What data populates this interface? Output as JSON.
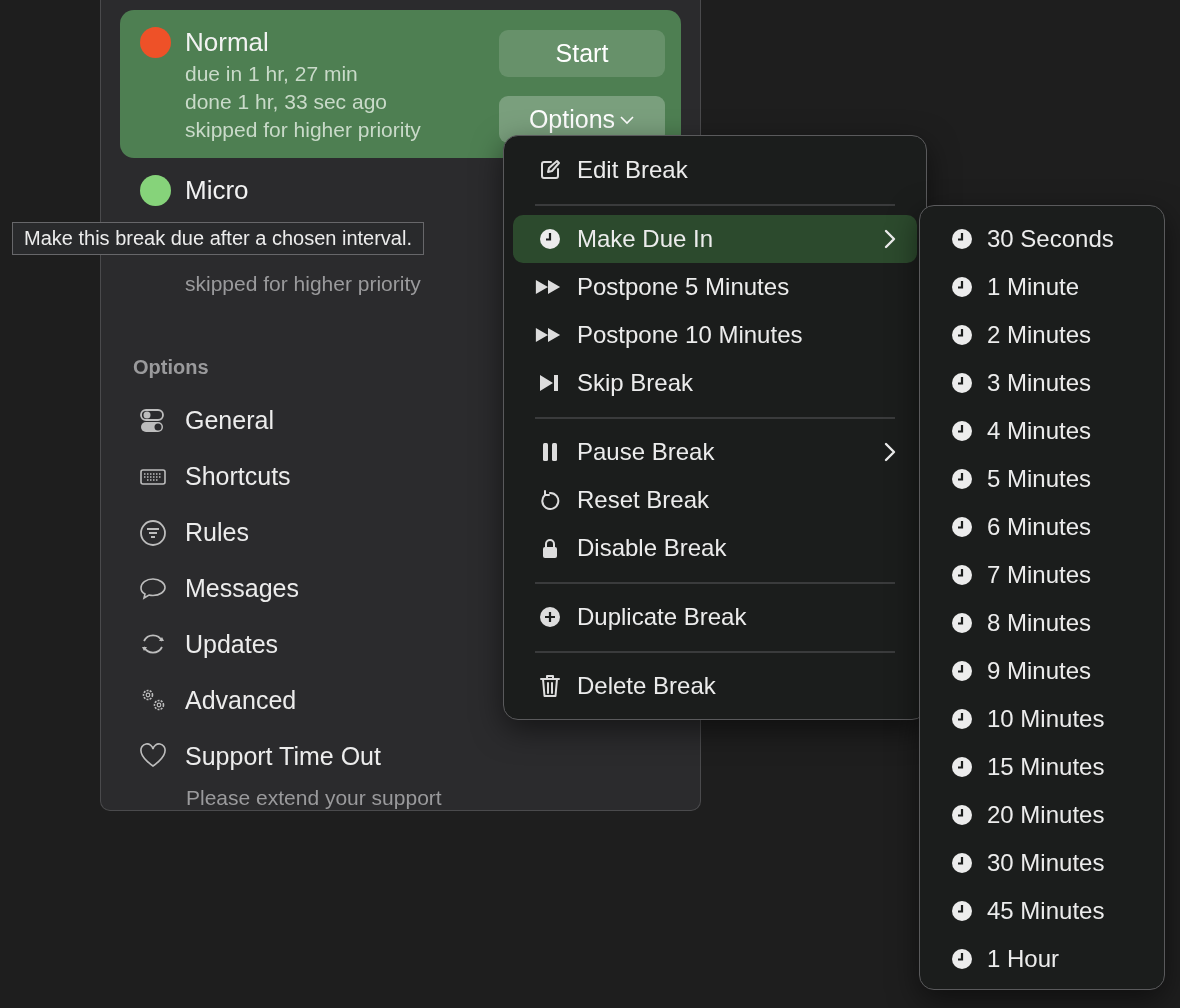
{
  "breaks": [
    {
      "name": "Normal",
      "color": "#ee5128",
      "selected": true,
      "lines": [
        "due in 1 hr, 27 min",
        "done 1 hr, 33 sec ago",
        "skipped for higher priority"
      ],
      "buttons": [
        {
          "label": "Start",
          "caret": false
        },
        {
          "label": "Options",
          "caret": true
        }
      ]
    },
    {
      "name": "Micro",
      "color": "#86d37a",
      "selected": false,
      "lines": [
        "skipped for higher priority"
      ]
    }
  ],
  "options": {
    "heading": "Options",
    "items": [
      "General",
      "Shortcuts",
      "Rules",
      "Messages",
      "Updates",
      "Advanced",
      "Support Time Out"
    ],
    "footer": "Please extend your support"
  },
  "tooltip": "Make this break due after a chosen interval.",
  "menu": {
    "groups": [
      [
        {
          "label": "Edit Break",
          "selected": false,
          "submenu": false
        }
      ],
      [
        {
          "label": "Make Due In",
          "selected": true,
          "submenu": true
        },
        {
          "label": "Postpone 5 Minutes",
          "selected": false,
          "submenu": false
        },
        {
          "label": "Postpone 10 Minutes",
          "selected": false,
          "submenu": false
        },
        {
          "label": "Skip Break",
          "selected": false,
          "submenu": false
        }
      ],
      [
        {
          "label": "Pause Break",
          "selected": false,
          "submenu": true
        },
        {
          "label": "Reset Break",
          "selected": false,
          "submenu": false
        },
        {
          "label": "Disable Break",
          "selected": false,
          "submenu": false
        }
      ],
      [
        {
          "label": "Duplicate Break",
          "selected": false,
          "submenu": false
        }
      ],
      [
        {
          "label": "Delete Break",
          "selected": false,
          "submenu": false
        }
      ]
    ]
  },
  "submenu": {
    "items": [
      "30 Seconds",
      "1 Minute",
      "2 Minutes",
      "3 Minutes",
      "4 Minutes",
      "5 Minutes",
      "6 Minutes",
      "7 Minutes",
      "8 Minutes",
      "9 Minutes",
      "10 Minutes",
      "15 Minutes",
      "20 Minutes",
      "30 Minutes",
      "45 Minutes",
      "1 Hour"
    ]
  }
}
